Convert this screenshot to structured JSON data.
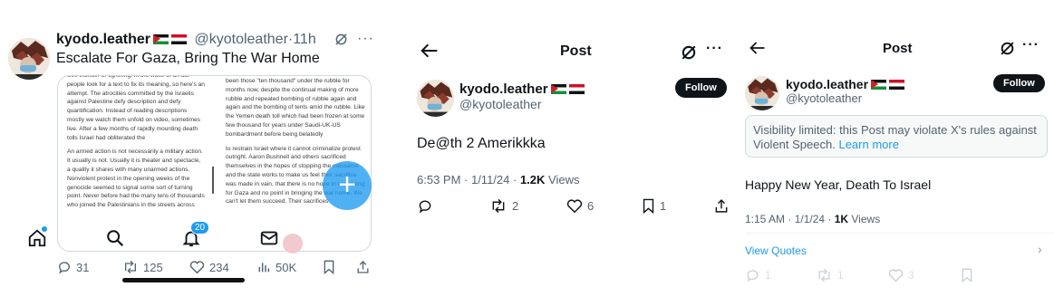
{
  "panel1": {
    "display_name": "kyodo.leather",
    "handle": "@kyotoleather",
    "separator": "·",
    "age": "11h",
    "text": "Escalate For Gaza, Bring The War Home",
    "media": {
      "colA": [
        "sive thunder or lightning. In the wake of an act people look for a text to fix its meaning, so here's an attempt. The atrocities committed by the Israelis against Palestine defy description and defy quantification. Instead of reading descriptions mostly we watch them unfold on video, sometimes live. After a few months of rapidly mounting death tolls Israel had obliterated the",
        "An armed action is not necessarily a military action. It usually is not. Usually it is theater and spectacle, a quality it shares with many unarmed actions. Nonviolent protest in the opening weeks of the genocide seemed to signal some sort of turning point. Never before had the many tens of thousands who joined the Palestinians in the streets across"
      ],
      "colB": [
        "been those \"ten thousand\" under the rubble for months now, despite the continual making of more rubble and repeated bombing of rubble again and again and the bombing of tents amid the rubble. Like the Yemen death toll which had been frozen at some few thousand for years under Saudi-UK-US bombardment before being belatedly",
        "to restrain Israel where it cannot criminalize protest outright. Aaron Bushnell and others sacrificed themselves in the hopes of stopping the massacre and the state works to make us feel their sacrifice was made in vain, that there is no hope in escalating for Gaza and no point in bringing the war home. We can't let them succeed. Their sacrifices"
      ]
    },
    "fab_label": "+",
    "notif_badge": "20",
    "actions": {
      "replies": "31",
      "reposts": "125",
      "likes": "234",
      "views": "50K"
    }
  },
  "panel2": {
    "title": "Post",
    "follow": "Follow",
    "display_name": "kyodo.leather",
    "handle": "@kyotoleather",
    "text": "De@th 2 Amerikkka",
    "time": "6:53 PM · 1/11/24 · ",
    "views_count": "1.2K",
    "views_label": " Views",
    "actions": {
      "replies": "",
      "reposts": "2",
      "likes": "6",
      "bookmarks": "1"
    }
  },
  "panel3": {
    "title": "Post",
    "follow": "Follow",
    "display_name": "kyodo.leather",
    "handle": "@kyotoleather",
    "notice": "Visibility limited: this Post may violate X's rules against Violent Speech.",
    "notice_link": "Learn more",
    "text": "Happy New Year, Death To Israel",
    "time": "1:15 AM · 1/1/24 · ",
    "views_count": "1K",
    "views_label": " Views",
    "view_quotes": "View Quotes",
    "actions": {
      "replies": "1",
      "reposts": "1",
      "likes": "3"
    }
  },
  "colors": {
    "accent": "#1d9bf0",
    "text": "#0f1419",
    "muted": "#536471",
    "border": "#cfd9de"
  }
}
